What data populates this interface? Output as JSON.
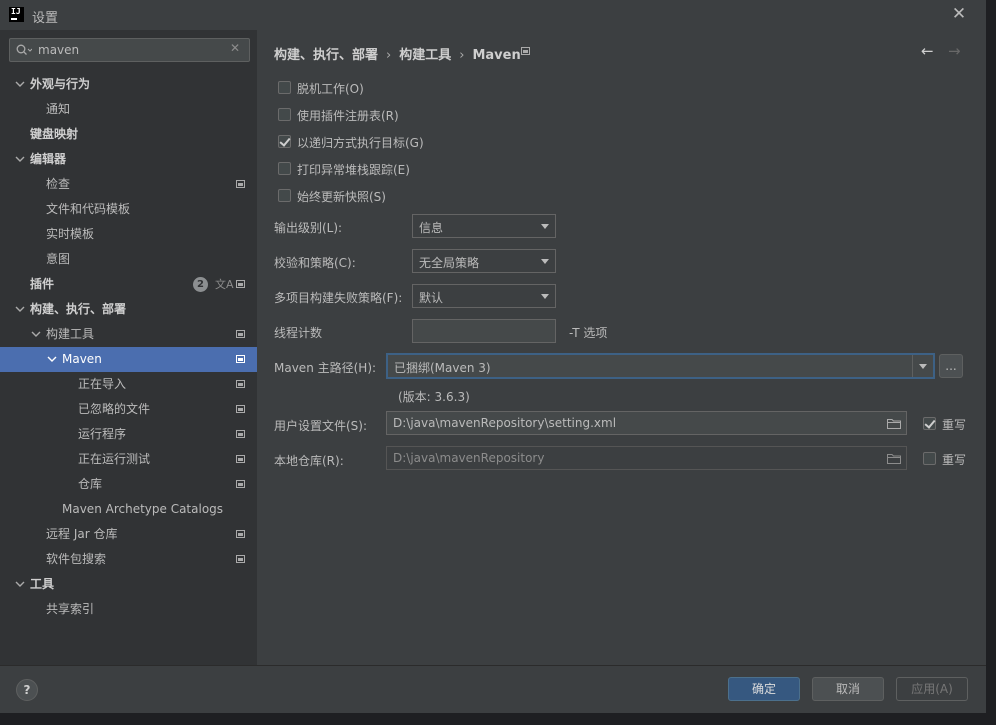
{
  "window": {
    "title": "设置",
    "logo_text": "IJ"
  },
  "search": {
    "value": "maven",
    "placeholder": ""
  },
  "tree": [
    {
      "label": "外观与行为",
      "bold": true,
      "expanded": true
    },
    {
      "label": "通知"
    },
    {
      "label": "键盘映射",
      "bold": true
    },
    {
      "label": "编辑器",
      "bold": true,
      "expanded": true
    },
    {
      "label": "检查",
      "project_icon": true
    },
    {
      "label": "文件和代码模板"
    },
    {
      "label": "实时模板"
    },
    {
      "label": "意图"
    },
    {
      "label": "插件",
      "bold": true,
      "badge": "2",
      "project_icon": true
    },
    {
      "label": "构建、执行、部署",
      "bold": true,
      "expanded": true
    },
    {
      "label": "构建工具",
      "expanded": true,
      "project_icon": true
    },
    {
      "label": "Maven",
      "expanded": true,
      "selected": true,
      "project_icon": true
    },
    {
      "label": "正在导入",
      "project_icon": true
    },
    {
      "label": "已忽略的文件",
      "project_icon": true
    },
    {
      "label": "运行程序",
      "project_icon": true
    },
    {
      "label": "正在运行测试",
      "project_icon": true
    },
    {
      "label": "仓库",
      "project_icon": true
    },
    {
      "label": "Maven Archetype Catalogs"
    },
    {
      "label": "远程 Jar 仓库",
      "project_icon": true
    },
    {
      "label": "软件包搜索",
      "project_icon": true
    },
    {
      "label": "工具",
      "bold": true,
      "expanded": true
    },
    {
      "label": "共享索引"
    }
  ],
  "breadcrumb": [
    "构建、执行、部署",
    "构建工具",
    "Maven"
  ],
  "sep": "›",
  "nav": {
    "back": "←",
    "forward": "→"
  },
  "options": [
    {
      "label": "脱机工作(O)",
      "checked": false
    },
    {
      "label": "使用插件注册表(R)",
      "checked": false
    },
    {
      "label": "以递归方式执行目标(G)",
      "checked": true
    },
    {
      "label": "打印异常堆栈跟踪(E)",
      "checked": false
    },
    {
      "label": "始终更新快照(S)",
      "checked": false
    }
  ],
  "fields": {
    "output_level": {
      "label": "输出级别(L):",
      "value": "信息"
    },
    "checksum": {
      "label": "校验和策略(C):",
      "value": "无全局策略"
    },
    "failure": {
      "label": "多项目构建失败策略(F):",
      "value": "默认"
    },
    "threads": {
      "label": "线程计数",
      "value": "",
      "hint": "-T 选项"
    },
    "maven_home": {
      "label": "Maven 主路径(H):",
      "value": "已捆绑(Maven 3)",
      "browse": "...",
      "version": "(版本: 3.6.3)"
    },
    "user_settings": {
      "label": "用户设置文件(S):",
      "value": "D:\\java\\mavenRepository\\setting.xml",
      "override": "重写",
      "override_checked": true
    },
    "local_repo": {
      "label": "本地仓库(R):",
      "value": "D:\\java\\mavenRepository",
      "override": "重写",
      "override_checked": false
    }
  },
  "footer": {
    "help": "?",
    "ok": "确定",
    "cancel": "取消",
    "apply": "应用(A)"
  }
}
